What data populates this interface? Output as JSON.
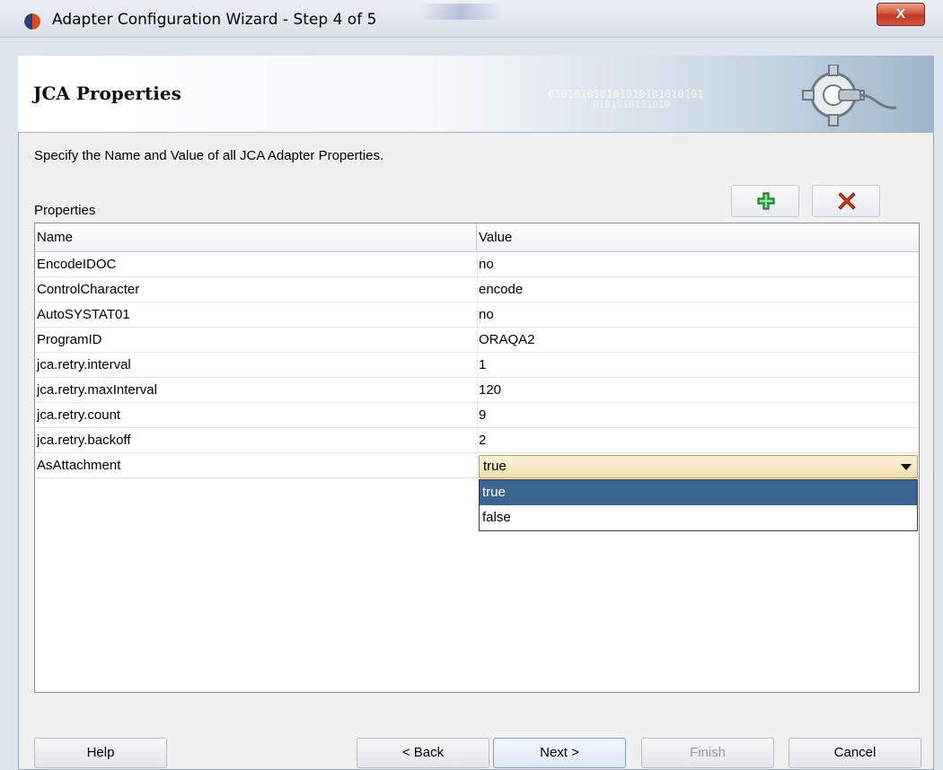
{
  "window": {
    "title": "Adapter Configuration Wizard - Step 4 of 5",
    "close_glyph": "X"
  },
  "banner": {
    "title": "JCA Properties",
    "binary_text_1": "010101010101010101010101",
    "binary_text_2": "0101010101010"
  },
  "instruction": "Specify the Name and Value of all JCA Adapter Properties.",
  "properties": {
    "label": "Properties",
    "add_icon": "add-plus-icon",
    "delete_icon": "delete-x-icon",
    "columns": [
      "Name",
      "Value"
    ],
    "rows": [
      {
        "name": "EncodeIDOC",
        "value": "no"
      },
      {
        "name": "ControlCharacter",
        "value": "encode"
      },
      {
        "name": "AutoSYSTAT01",
        "value": "no"
      },
      {
        "name": "ProgramID",
        "value": "ORAQA2"
      },
      {
        "name": "jca.retry.interval",
        "value": "1"
      },
      {
        "name": "jca.retry.maxInterval",
        "value": "120"
      },
      {
        "name": "jca.retry.count",
        "value": "9"
      },
      {
        "name": "jca.retry.backoff",
        "value": "2"
      },
      {
        "name": "AsAttachment",
        "value": "true"
      }
    ],
    "combo": {
      "selected": "true",
      "options": [
        "true",
        "false"
      ]
    }
  },
  "buttons": {
    "help": "Help",
    "back": "< Back",
    "next": "Next >",
    "finish": "Finish",
    "cancel": "Cancel"
  },
  "colors": {
    "selection": "#3b6591",
    "add_icon": "#2e9d3a",
    "delete_icon": "#d2301f",
    "close_button": "#c1382a"
  }
}
